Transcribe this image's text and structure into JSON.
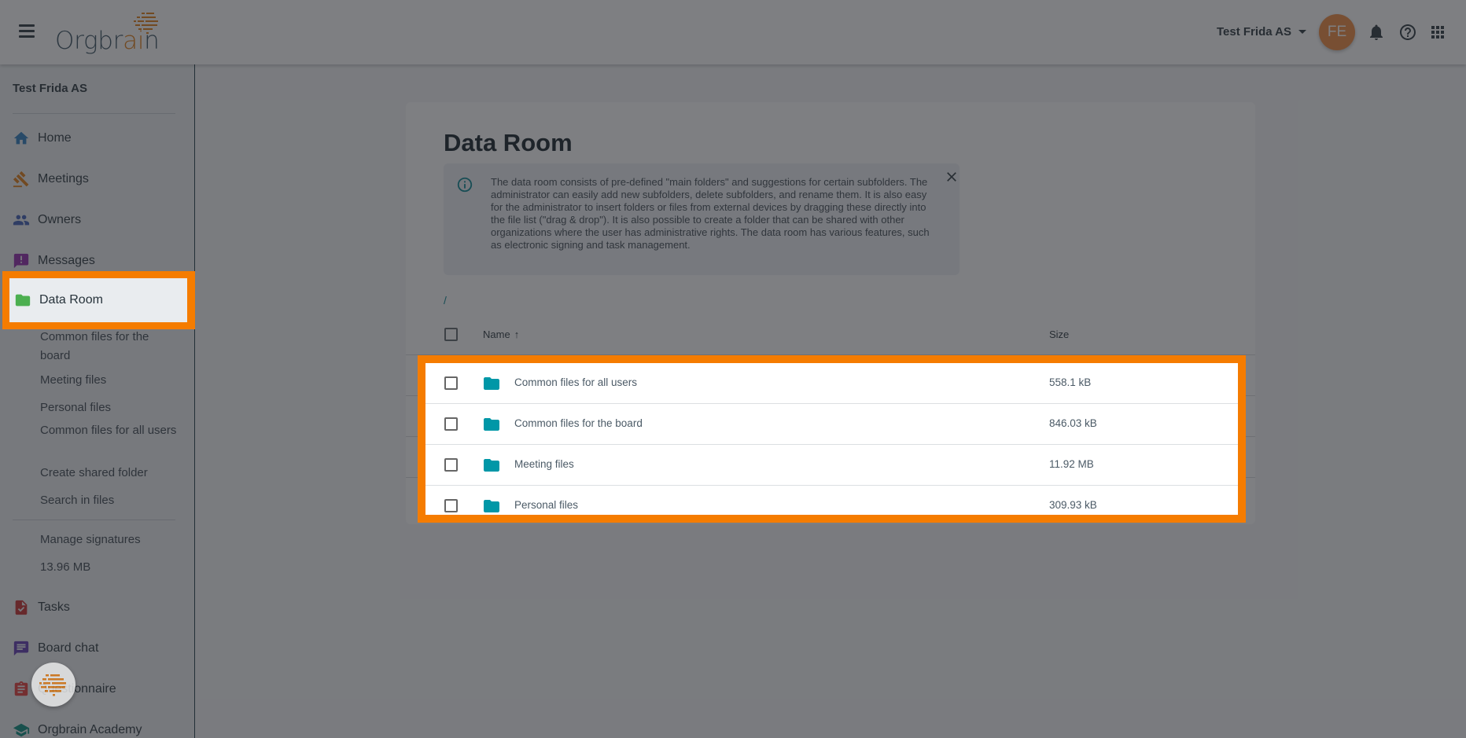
{
  "header": {
    "app_name_prefix": "Orgbr",
    "app_name_accent": "ai",
    "app_name_suffix": "n",
    "org_selector": "Test Frida AS",
    "avatar_initials": "FE",
    "icons": [
      "menu-icon",
      "notifications-icon",
      "help-icon",
      "apps-grid-icon"
    ]
  },
  "sidebar": {
    "org_name": "Test Frida AS",
    "items": [
      {
        "label": "Home",
        "icon": "home-icon",
        "color": "#2a7bbf"
      },
      {
        "label": "Meetings",
        "icon": "gavel-icon",
        "color": "#e07a10"
      },
      {
        "label": "Owners",
        "icon": "people-icon",
        "color": "#3b5bb5"
      },
      {
        "label": "Messages",
        "icon": "message-alert-icon",
        "color": "#8e24aa"
      },
      {
        "label": "Data Room",
        "icon": "folder-icon",
        "color": "#4caf50",
        "active": true
      },
      {
        "label": "Tasks",
        "icon": "task-icon",
        "color": "#c62828"
      },
      {
        "label": "Board chat",
        "icon": "chat-icon",
        "color": "#5e35b1"
      },
      {
        "label": "Questionnaire",
        "icon": "clipboard-icon",
        "color": "#e53935"
      },
      {
        "label": "Orgbrain Academy",
        "icon": "school-icon",
        "color": "#00897b"
      }
    ],
    "dataroom_subitems": [
      "Common files for the board",
      "Meeting files",
      "Personal files",
      "Common files for all users",
      "Create shared folder",
      "Search in files"
    ],
    "extra_items": [
      "Manage signatures",
      "13.96 MB"
    ]
  },
  "main": {
    "title": "Data Room",
    "info_text": "The data room consists of pre-defined \"main folders\" and suggestions for certain subfolders. The administrator can easily add new subfolders, delete subfolders, and rename them. It is also easy for the administrator to insert folders or files from external devices by dragging these directly into the file list (\"drag & drop\"). It is also possible to create a folder that can be shared with other organizations where the user has administrative rights. The data room has various features, such as electronic signing and task management.",
    "breadcrumb": "/",
    "table": {
      "columns": [
        "Name",
        "Size"
      ],
      "sort_indicator": "↑",
      "rows": [
        {
          "name": "Common files for all users",
          "size": "558.1 kB"
        },
        {
          "name": "Common files for the board",
          "size": "846.03 kB"
        },
        {
          "name": "Meeting files",
          "size": "11.92 MB"
        },
        {
          "name": "Personal files",
          "size": "309.93 kB"
        }
      ]
    }
  },
  "colors": {
    "accent": "#f57c00",
    "folder": "#0097a7",
    "brand_orange": "#e07a10"
  }
}
